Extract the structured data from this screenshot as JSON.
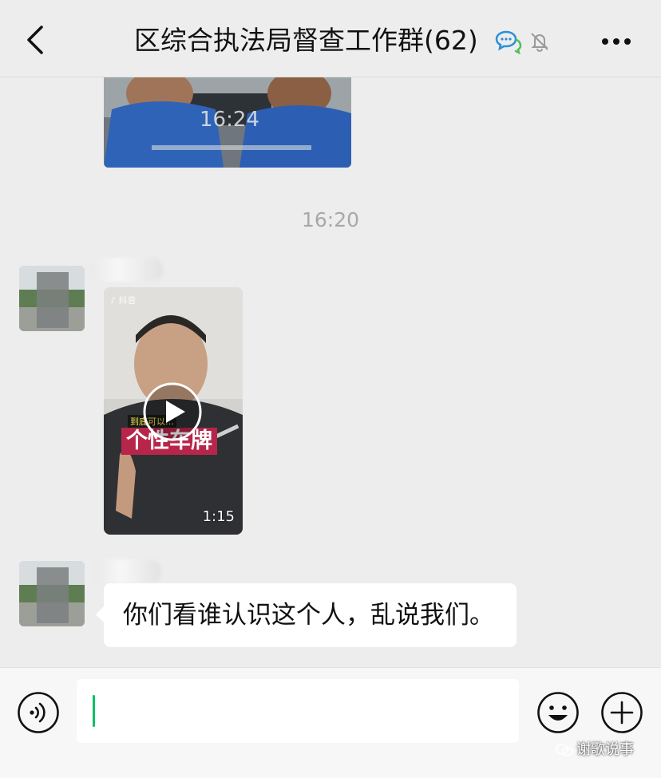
{
  "header": {
    "title": "区综合执法局督查工作群(62)",
    "back_icon": "chevron-left-icon",
    "chat_icon": "chat-bubbles-icon",
    "mute_icon": "bell-muted-icon",
    "more_icon": "more-dots-icon"
  },
  "messages": {
    "photo": {
      "overlay_time": "16:24"
    },
    "time_separator": "16:20",
    "video": {
      "duration": "1:15",
      "caption": "个性车牌",
      "subcaption": "到底可以…"
    },
    "text_message": "你们看谁认识这个人，乱说我们。"
  },
  "input_bar": {
    "voice_icon": "voice-icon",
    "emoji_icon": "emoji-icon",
    "plus_icon": "plus-icon",
    "input_value": ""
  },
  "watermark": "谢歌说事",
  "colors": {
    "accent": "#07c160",
    "background": "#ededed",
    "bubble": "#ffffff"
  }
}
